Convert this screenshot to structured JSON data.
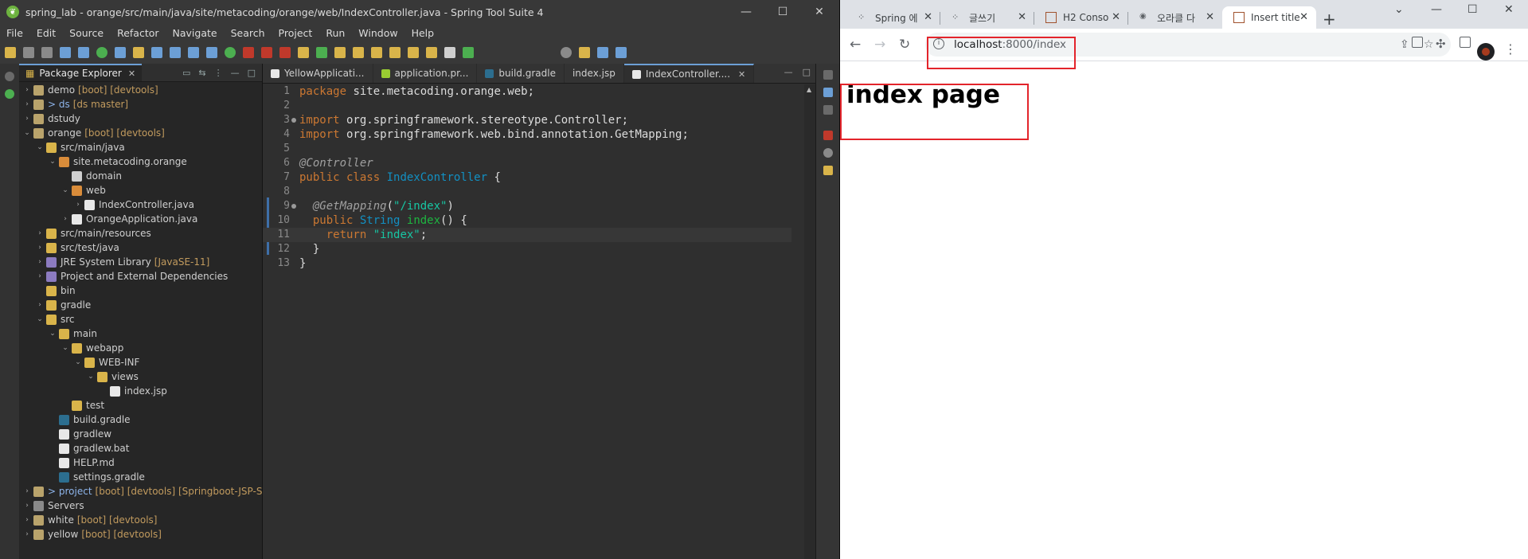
{
  "ide": {
    "title": "spring_lab - orange/src/main/java/site/metacoding/orange/web/IndexController.java - Spring Tool Suite 4",
    "menus": [
      "File",
      "Edit",
      "Source",
      "Refactor",
      "Navigate",
      "Search",
      "Project",
      "Run",
      "Window",
      "Help"
    ],
    "window_controls": [
      "—",
      "☐",
      "✕"
    ],
    "package_explorer": {
      "tab_label": "Package Explorer",
      "nodes": [
        {
          "label": "demo",
          "decoration": "[boot] [devtools]"
        },
        {
          "label": "> ds",
          "decoration": "[ds master]"
        },
        {
          "label": "dstudy",
          "decoration": ""
        },
        {
          "label": "orange",
          "decoration": "[boot] [devtools]"
        },
        {
          "label": "src/main/java",
          "decoration": ""
        },
        {
          "label": "site.metacoding.orange",
          "decoration": ""
        },
        {
          "label": "domain",
          "decoration": ""
        },
        {
          "label": "web",
          "decoration": ""
        },
        {
          "label": "IndexController.java",
          "decoration": ""
        },
        {
          "label": "OrangeApplication.java",
          "decoration": ""
        },
        {
          "label": "src/main/resources",
          "decoration": ""
        },
        {
          "label": "src/test/java",
          "decoration": ""
        },
        {
          "label": "JRE System Library",
          "decoration": "[JavaSE-11]"
        },
        {
          "label": "Project and External Dependencies",
          "decoration": ""
        },
        {
          "label": "bin",
          "decoration": ""
        },
        {
          "label": "gradle",
          "decoration": ""
        },
        {
          "label": "src",
          "decoration": ""
        },
        {
          "label": "main",
          "decoration": ""
        },
        {
          "label": "webapp",
          "decoration": ""
        },
        {
          "label": "WEB-INF",
          "decoration": ""
        },
        {
          "label": "views",
          "decoration": ""
        },
        {
          "label": "index.jsp",
          "decoration": ""
        },
        {
          "label": "test",
          "decoration": ""
        },
        {
          "label": "build.gradle",
          "decoration": ""
        },
        {
          "label": "gradlew",
          "decoration": ""
        },
        {
          "label": "gradlew.bat",
          "decoration": ""
        },
        {
          "label": "HELP.md",
          "decoration": ""
        },
        {
          "label": "settings.gradle",
          "decoration": ""
        },
        {
          "label": "> project",
          "decoration": "[boot] [devtools] [Springboot-JSP-Set r"
        },
        {
          "label": "Servers",
          "decoration": ""
        },
        {
          "label": "white",
          "decoration": "[boot] [devtools]"
        },
        {
          "label": "yellow",
          "decoration": "[boot] [devtools]"
        }
      ]
    },
    "editor": {
      "tabs": [
        "YellowApplicati...",
        "application.pr...",
        "build.gradle",
        "index.jsp",
        "IndexController...."
      ],
      "line_numbers": [
        "1",
        "2",
        "3",
        "4",
        "5",
        "6",
        "7",
        "8",
        "9",
        "10",
        "11",
        "12",
        "13"
      ],
      "tokens": {
        "l1_kw": "package",
        "l1_rest": " site.metacoding.orange.web;",
        "l3_kw": "import",
        "l3_rest": " org.springframework.stereotype.Controller;",
        "l4_kw": "import",
        "l4_rest": " org.springframework.web.bind.annotation.GetMapping;",
        "l6_ann": "@Controller",
        "l7_kw": "public class",
        "l7_cls": "IndexController",
        "l7_rest": " {",
        "l9_ann": "@GetMapping",
        "l9_open": "(",
        "l9_str": "\"/index\"",
        "l9_close": ")",
        "l10_kw": "public",
        "l10_cls": "String",
        "l10_met": "index",
        "l10_rest": "() {",
        "l11_kw": "return",
        "l11_str": "\"index\"",
        "l11_rest": ";",
        "l12": "}",
        "l13": "}"
      }
    }
  },
  "browser": {
    "tabs": [
      "Spring 에",
      "글쓰기",
      "H2 Conso",
      "오라클 다",
      "Insert title"
    ],
    "new_tab": "+",
    "window_controls": [
      "⌄",
      "—",
      "☐",
      "✕"
    ],
    "url_host": "localhost",
    "url_path": ":8000/index",
    "page_heading": "index page"
  },
  "colors": {
    "highlight_box": "#e3242b",
    "keyword": "#cc7832",
    "class_name": "#1290c3",
    "string": "#17c6a3",
    "method": "#1eb540"
  }
}
